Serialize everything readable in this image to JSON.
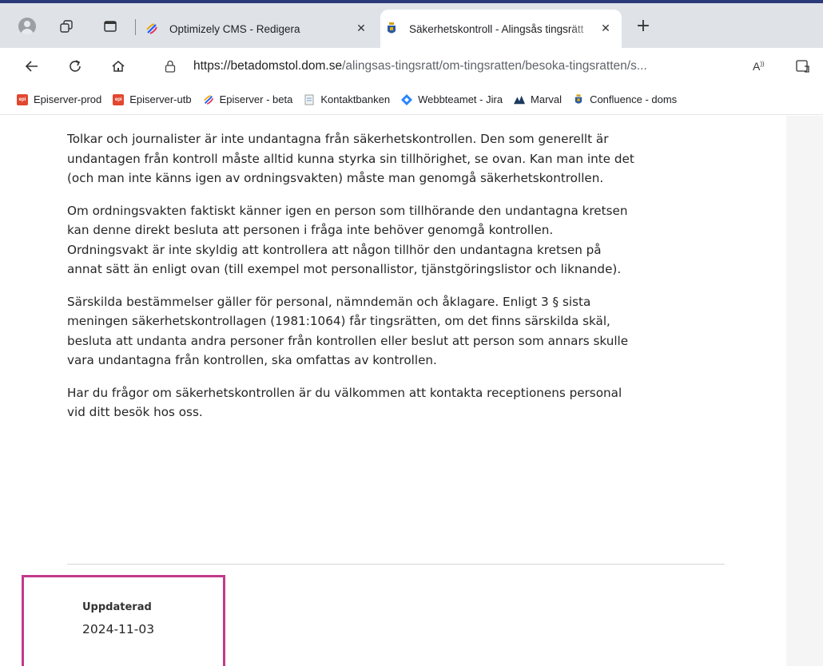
{
  "browser": {
    "tabs": [
      {
        "title": "Optimizely CMS - Redigera",
        "active": false
      },
      {
        "title": "Säkerhetskontroll - Alingsås tingsrätt",
        "active": true
      }
    ],
    "address": {
      "url_host": "https://betadomstol.dom.se",
      "url_path": "/alingsas-tingsratt/om-tingsratten/besoka-tingsratten/s..."
    },
    "bookmarks": [
      {
        "label": "Episerver-prod",
        "icon": "episerver-icon"
      },
      {
        "label": "Episerver-utb",
        "icon": "episerver-icon"
      },
      {
        "label": "Episerver - beta",
        "icon": "optimizely-icon"
      },
      {
        "label": "Kontaktbanken",
        "icon": "document-icon"
      },
      {
        "label": "Webbteamet - Jira",
        "icon": "jira-icon"
      },
      {
        "label": "Marval",
        "icon": "marval-icon"
      },
      {
        "label": "Confluence - doms",
        "icon": "crest-icon"
      }
    ]
  },
  "article": {
    "paragraphs": [
      "Tolkar och journalister är inte undantagna från säkerhetskontrollen. Den som generellt är undantagen från kontroll måste alltid kunna styrka sin tillhörighet, se ovan. Kan man inte det (och man inte känns igen av ordningsvakten) måste man genomgå säkerhetskontrollen.",
      "Om ordningsvakten faktiskt känner igen en person som tillhörande den undantagna kretsen kan denne direkt besluta att personen i fråga inte behöver genomgå kontrollen. Ordningsvakt är inte skyldig att kontrollera att någon tillhör den undantagna kretsen på annat sätt än enligt ovan (till exempel mot personallistor, tjänstgöringslistor och liknande).",
      "Särskilda bestämmelser gäller för personal, nämndemän och åklagare. Enligt 3 § sista meningen säkerhetskontrollagen (1981:1064) får tingsrätten, om det finns särskilda skäl, besluta att undanta andra personer från kontrollen eller beslut att person som annars skulle vara undantagna från kontrollen, ska omfattas av kontrollen.",
      "Har du frågor om säkerhetskontrollen är du välkommen att kontakta receptionens personal vid ditt besök hos oss."
    ]
  },
  "updated": {
    "label": "Uppdaterad",
    "date": "2024-11-03"
  },
  "colors": {
    "highlight_border": "#c23a8a",
    "tabstrip_bg": "#dfe3e8"
  }
}
